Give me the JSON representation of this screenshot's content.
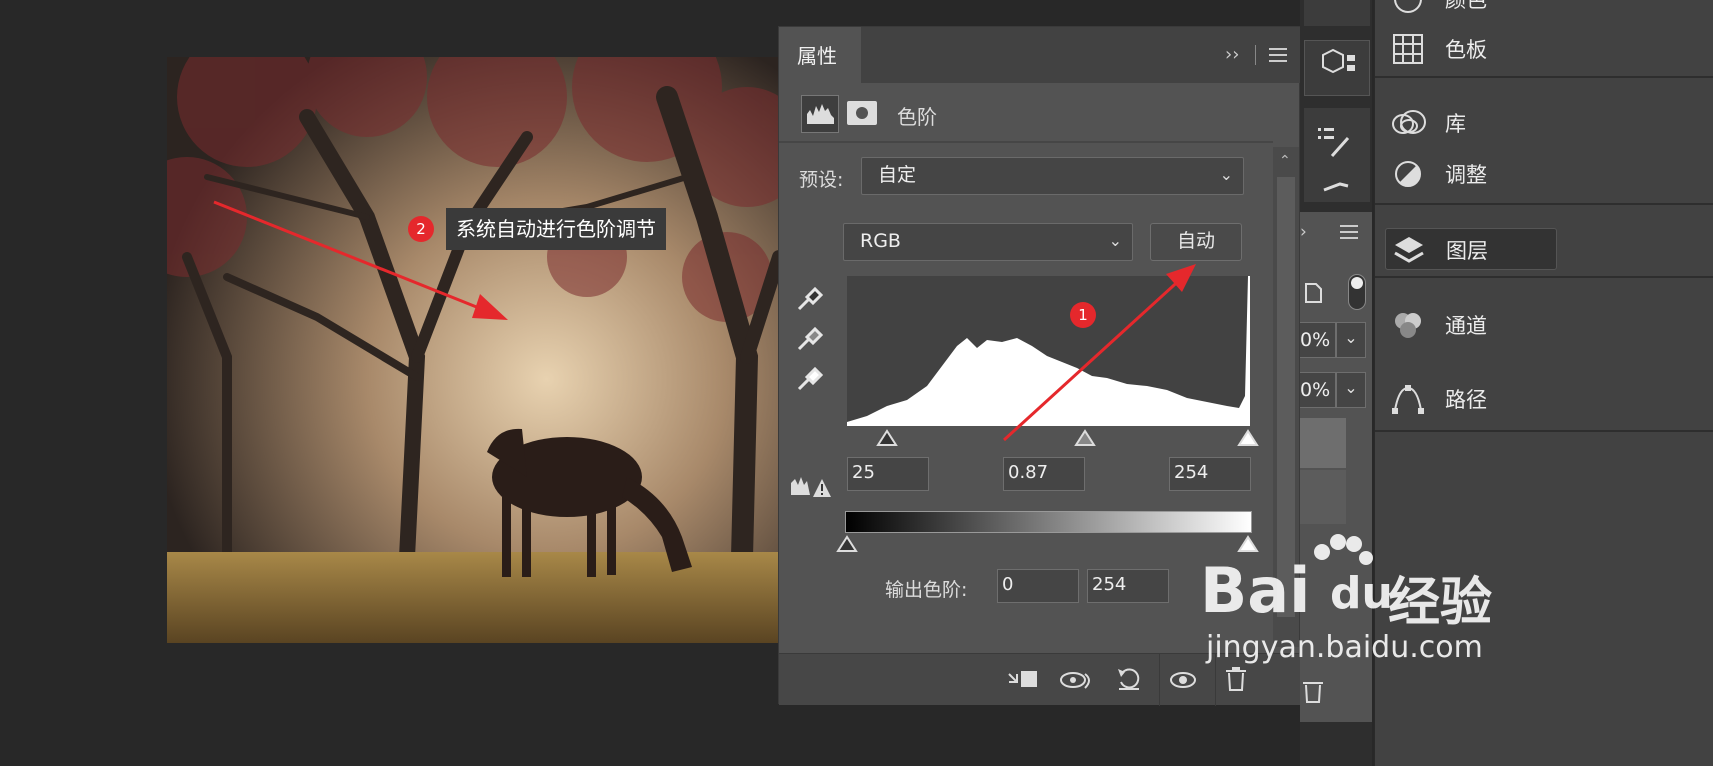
{
  "panel": {
    "tab_label": "属性",
    "adjustment_name": "色阶",
    "preset_label": "预设:",
    "preset_value": "自定",
    "channel_value": "RGB",
    "auto_button": "自动",
    "input_black": "25",
    "input_gamma": "0.87",
    "input_white": "254",
    "output_label": "输出色阶:",
    "output_black": "0",
    "output_white": "254"
  },
  "dock": {
    "items": [
      {
        "label": "颜色",
        "icon": "color-icon"
      },
      {
        "label": "色板",
        "icon": "swatches-icon"
      },
      {
        "label": "库",
        "icon": "libraries-icon"
      },
      {
        "label": "调整",
        "icon": "adjustments-icon"
      },
      {
        "label": "图层",
        "icon": "layers-icon"
      },
      {
        "label": "通道",
        "icon": "channels-icon"
      },
      {
        "label": "路径",
        "icon": "paths-icon"
      }
    ],
    "percent_1": "0%",
    "percent_2": "0%"
  },
  "annotations": {
    "badge_1": "1",
    "badge_2": "2",
    "tooltip_2": "系统自动进行色阶调节"
  },
  "watermark": {
    "brand": "Bai",
    "brand2": "du",
    "brand_cn": "经验",
    "url": "jingyan.baidu.com"
  },
  "colors": {
    "accent_red": "#e5282c",
    "panel_bg": "#535353",
    "dock_bg": "#424242"
  }
}
